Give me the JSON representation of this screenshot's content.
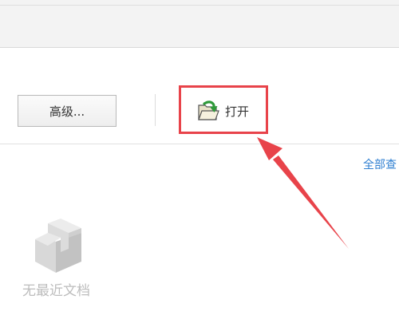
{
  "toolbar": {
    "advanced_label": "高级...",
    "open_label": "打开"
  },
  "recent": {
    "show_all_label": "全部查",
    "empty_text": "无最近文档"
  },
  "annotation": {
    "highlight_color": "#e8434a"
  },
  "icons": {
    "open": "folder-open-arrow-icon",
    "empty": "empty-document-cube-icon"
  }
}
